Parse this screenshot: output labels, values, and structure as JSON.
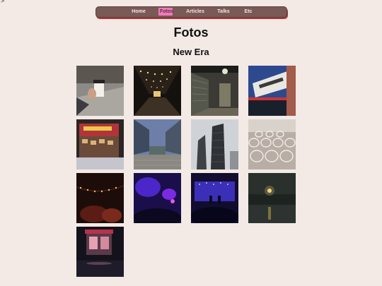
{
  "corner_text": ">",
  "nav": {
    "items": [
      {
        "label": "Home"
      },
      {
        "label": "Fotos",
        "active": true
      },
      {
        "label": "Articles"
      },
      {
        "label": "Talks"
      },
      {
        "label": "Etc"
      }
    ]
  },
  "page": {
    "title": "Fotos",
    "subtitle": "New Era"
  },
  "photos": [
    {
      "subject": "coffee-cup-photo"
    },
    {
      "subject": "tunnel-lights-photo"
    },
    {
      "subject": "alley-photo"
    },
    {
      "subject": "building-facade-photo"
    },
    {
      "subject": "market-stall-photo"
    },
    {
      "subject": "plaza-photo"
    },
    {
      "subject": "towers-photo"
    },
    {
      "subject": "glasses-photo"
    },
    {
      "subject": "string-lights-photo"
    },
    {
      "subject": "club-photo"
    },
    {
      "subject": "concert-photo"
    },
    {
      "subject": "rainy-street-photo"
    },
    {
      "subject": "kiosk-night-photo"
    }
  ]
}
